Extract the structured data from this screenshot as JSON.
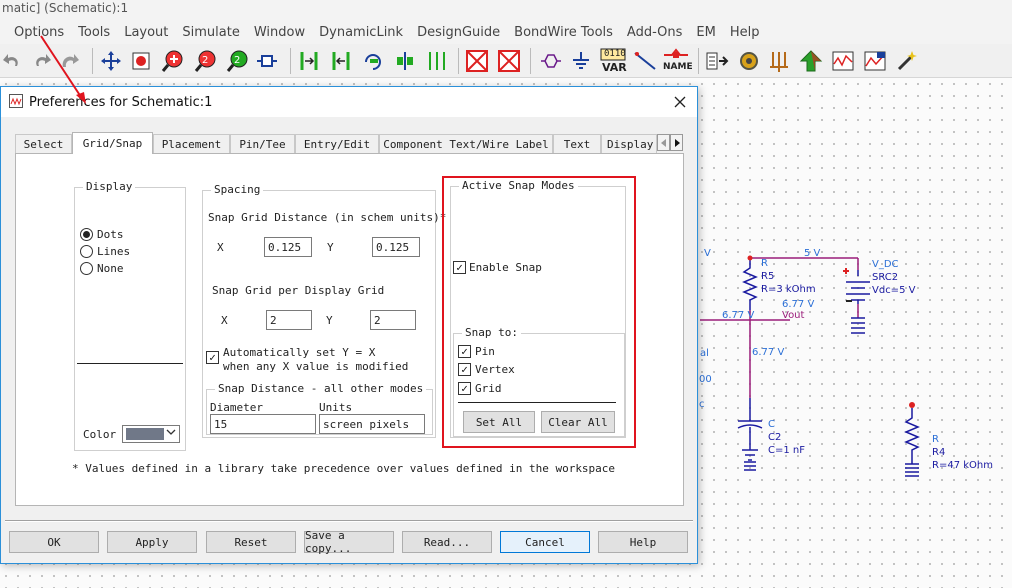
{
  "app": {
    "window_title": "matic] (Schematic):1",
    "menu": [
      "Options",
      "Tools",
      "Layout",
      "Simulate",
      "Window",
      "DynamicLink",
      "DesignGuide",
      "BondWire Tools",
      "Add-Ons",
      "EM",
      "Help"
    ],
    "toolbar_icons": [
      "undo-icon",
      "redo-icon",
      "redo-alt-icon",
      "move-icon",
      "stop-icon",
      "zoom-in-icon",
      "zoom-area-icon",
      "zoom-out-icon",
      "port-icon",
      "wire-icon",
      "wire-alt-icon",
      "rotate-icon",
      "flip-icon",
      "align-icon",
      "deactivate-icon",
      "short-icon",
      "component-icon",
      "ground-icon",
      "var-icon",
      "wire-draw-icon",
      "name-icon",
      "simulate-icon",
      "tune-icon",
      "optimize-icon",
      "plot-icon",
      "data-display-icon",
      "magic-icon"
    ],
    "var_label": "VAR",
    "var_top": "0110",
    "name_label": "NAME"
  },
  "schematic": {
    "labels": {
      "v_left": "V",
      "five_v": "5 V",
      "r_label": "R",
      "r5": "R5",
      "r5_value": "R=3 kOhm",
      "v677_a": "6.77 V",
      "v677_b": "6.77 V",
      "vout": "Vout",
      "v677_c": "6.77 V",
      "al": "al",
      "zero": "00",
      "c_small": "c",
      "c_label": "C",
      "c2": "C2",
      "c2_value": "C=1 nF",
      "vdc": "V_DC",
      "src2": "SRC2",
      "vdc_value": "Vdc=5 V",
      "r_label2": "R",
      "r4": "R4",
      "r4_value": "R=47 kOhm"
    },
    "colors": {
      "wire": "#9a1d7a",
      "component": "#1a1aa0",
      "label": "#2b6fd6"
    }
  },
  "dialog": {
    "title": "Preferences for Schematic:1",
    "tabs": [
      "Select",
      "Grid/Snap",
      "Placement",
      "Pin/Tee",
      "Entry/Edit",
      "Component Text/Wire Label",
      "Text",
      "Display"
    ],
    "active_tab": "Grid/Snap",
    "display_group": {
      "label": "Display",
      "options": [
        "Dots",
        "Lines",
        "None"
      ],
      "selected": "Dots",
      "color_label": "Color",
      "color_value": "#707888"
    },
    "spacing_group": {
      "label": "Spacing",
      "snap_grid_label": "Snap Grid Distance (in schem units)*",
      "x_label": "X",
      "x_value": "0.125",
      "y_label": "Y",
      "y_value": "0.125",
      "per_display_label": "Snap Grid per Display Grid",
      "px_label": "X",
      "px_value": "2",
      "py_label": "Y",
      "py_value": "2",
      "auto_line1": "Automatically set Y = X",
      "auto_line2": "when any X value is modified",
      "auto_checked": true
    },
    "snap_distance_group": {
      "label": "Snap Distance - all other modes",
      "diameter_label": "Diameter",
      "diameter_value": "15",
      "units_label": "Units",
      "units_value": "screen pixels"
    },
    "active_snap_group": {
      "label": "Active Snap Modes",
      "enable_label": "Enable Snap",
      "enable_checked": true,
      "snap_to_label": "Snap to:",
      "pin_label": "Pin",
      "vertex_label": "Vertex",
      "grid_label": "Grid",
      "set_all": "Set All",
      "clear_all": "Clear All"
    },
    "footnote": "* Values defined in a library take precedence over values defined in the workspace",
    "buttons": [
      "OK",
      "Apply",
      "Reset",
      "Save a copy...",
      "Read...",
      "Cancel",
      "Help"
    ]
  }
}
